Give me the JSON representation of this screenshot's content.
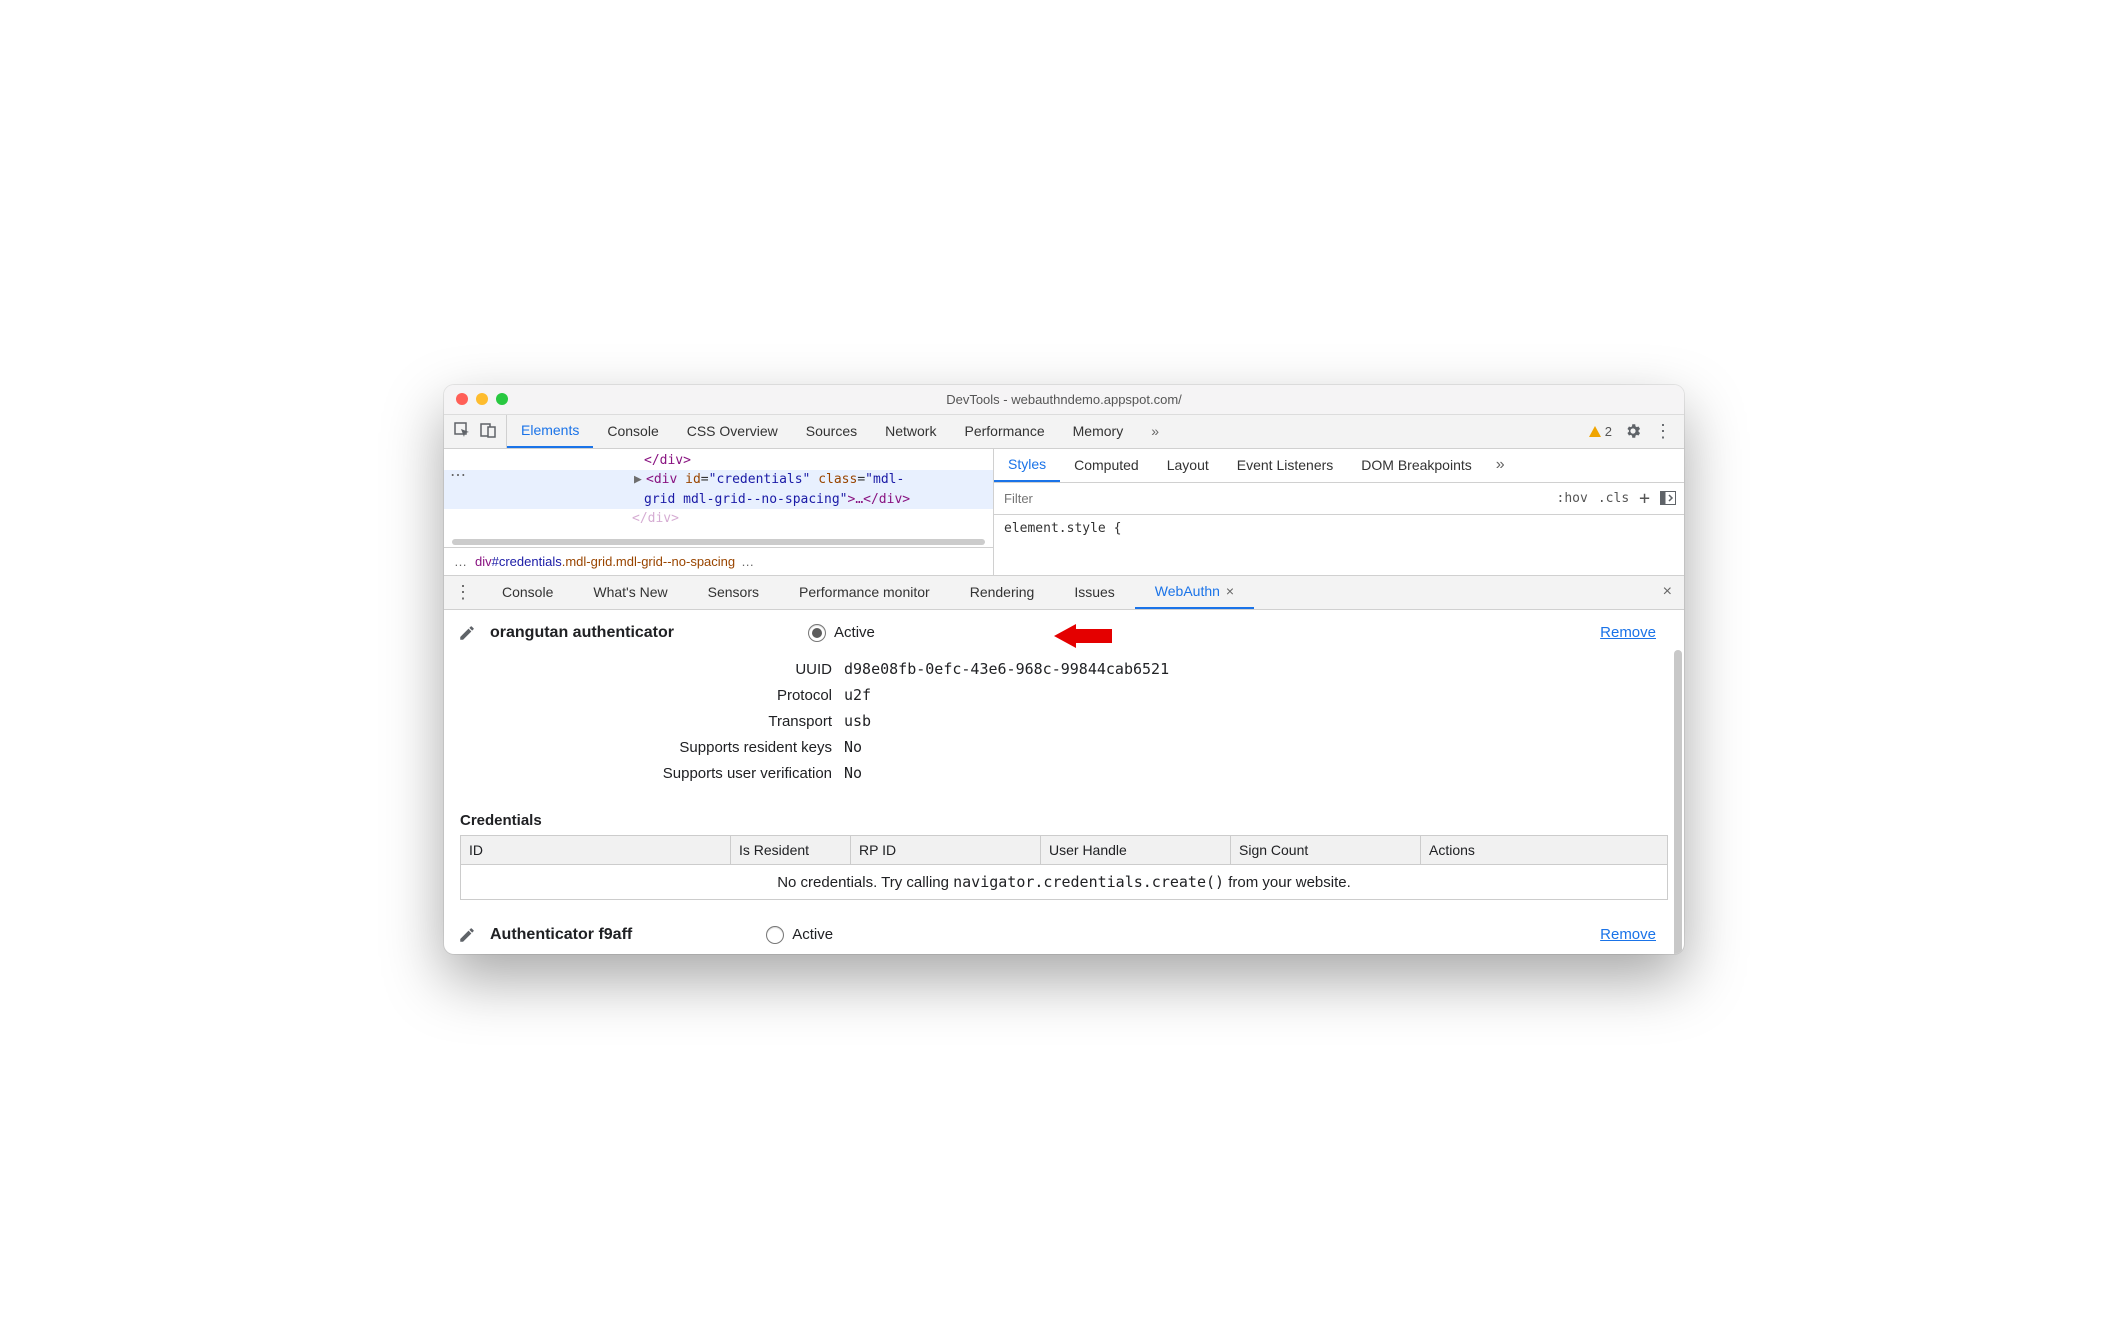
{
  "titlebar": {
    "title": "DevTools - webauthndemo.appspot.com/"
  },
  "toolbar": {
    "tabs": [
      "Elements",
      "Console",
      "CSS Overview",
      "Sources",
      "Network",
      "Performance",
      "Memory"
    ],
    "active_tab_index": 0,
    "more_glyph": "»",
    "warning_count": "2"
  },
  "elements_pane": {
    "line0": "</div>",
    "line1_prefix": "▶",
    "line1_open": "<div ",
    "line1_id_attr": "id",
    "line1_id_val": "\"credentials\"",
    "line1_class_attr": "class",
    "line1_class_val": "\"mdl-",
    "line2_class_cont": "grid mdl-grid--no-spacing\"",
    "line2_close": ">…</div>",
    "line3": "</div>",
    "breadcrumb": {
      "pre": "…",
      "el": "div",
      "id": "#credentials",
      "cls1": ".mdl-grid",
      "cls2": ".mdl-grid--no-spacing",
      "post": "…"
    }
  },
  "styles_pane": {
    "tabs": [
      "Styles",
      "Computed",
      "Layout",
      "Event Listeners",
      "DOM Breakpoints"
    ],
    "active_tab_index": 0,
    "filter_placeholder": "Filter",
    "hov": ":hov",
    "cls": ".cls",
    "rule": "element.style {"
  },
  "drawer": {
    "tabs": [
      "Console",
      "What's New",
      "Sensors",
      "Performance monitor",
      "Rendering",
      "Issues",
      "WebAuthn"
    ],
    "active_tab_index": 6
  },
  "webauthn": {
    "auth1": {
      "name": "orangutan authenticator",
      "active_label": "Active",
      "remove": "Remove",
      "fields": {
        "uuid_label": "UUID",
        "uuid_val": "d98e08fb-0efc-43e6-968c-99844cab6521",
        "protocol_label": "Protocol",
        "protocol_val": "u2f",
        "transport_label": "Transport",
        "transport_val": "usb",
        "resident_label": "Supports resident keys",
        "resident_val": "No",
        "userver_label": "Supports user verification",
        "userver_val": "No"
      }
    },
    "credentials_heading": "Credentials",
    "table": {
      "id": "ID",
      "is_resident": "Is Resident",
      "rp_id": "RP ID",
      "user_handle": "User Handle",
      "sign_count": "Sign Count",
      "actions": "Actions"
    },
    "empty_pre": "No credentials. Try calling ",
    "empty_code": "navigator.credentials.create()",
    "empty_post": " from your website.",
    "auth2": {
      "name": "Authenticator f9aff",
      "active_label": "Active",
      "remove": "Remove"
    }
  }
}
